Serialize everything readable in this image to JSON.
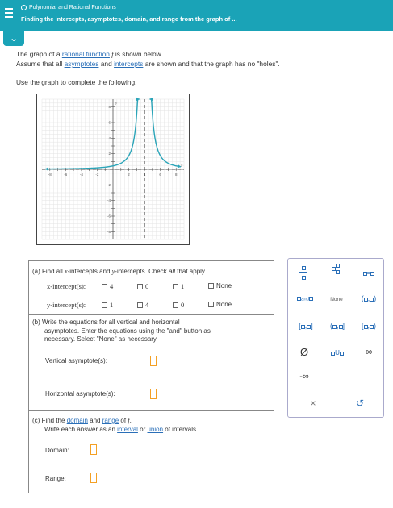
{
  "header": {
    "topic": "Polynomial and Rational Functions",
    "title": "Finding the intercepts, asymptotes, domain, and range from the graph of ..."
  },
  "intro": {
    "line1_a": "The graph of a ",
    "line1_link": "rational function",
    "line1_b": " ",
    "line1_f": "f",
    "line1_c": " is shown below.",
    "line2_a": "Assume that all ",
    "line2_link1": "asymptotes",
    "line2_b": " and ",
    "line2_link2": "intercepts",
    "line2_c": " are shown and that the graph has no \"holes\".",
    "line3": "Use the graph to complete the following."
  },
  "graph": {
    "y_label": "y",
    "x_label": "x",
    "x_tick_labels": [
      "-8",
      "-6",
      "-4",
      "-2",
      "2",
      "4",
      "6",
      "8"
    ],
    "y_tick_labels": [
      "8",
      "6",
      "4",
      "2",
      "-2",
      "-4",
      "-6",
      "-8"
    ]
  },
  "chart_data": {
    "type": "line",
    "title": "",
    "xlabel": "x",
    "ylabel": "y",
    "xlim": [
      -9,
      9
    ],
    "ylim": [
      -9,
      9
    ],
    "grid": true,
    "vertical_asymptote": 4,
    "horizontal_asymptote": 0,
    "series": [
      {
        "x": [
          -8.5,
          -6,
          -4,
          -2,
          0,
          1,
          2,
          2.8,
          3.2,
          3.5,
          3.7
        ],
        "y": [
          0.19,
          0.3,
          0.5,
          0.89,
          1.75,
          3.11,
          7,
          19.4,
          43.7,
          112,
          311
        ]
      },
      {
        "x": [
          4.3,
          4.5,
          4.8,
          5.2,
          6,
          7,
          8,
          8.5
        ],
        "y": [
          311,
          112,
          43.7,
          19.4,
          7,
          3.11,
          1.75,
          1.38
        ]
      }
    ]
  },
  "part_a": {
    "prompt_a": "(a) Find all ",
    "prompt_x": "x",
    "prompt_b": "-intercepts and ",
    "prompt_y": "y",
    "prompt_c": "-intercepts. Check ",
    "prompt_all": "all",
    "prompt_d": " that apply.",
    "x_label": "x-intercept(s):",
    "y_label": "y-intercept(s):",
    "x_options": [
      "4",
      "0",
      "1",
      "None"
    ],
    "y_options": [
      "1",
      "4",
      "0",
      "None"
    ]
  },
  "part_b": {
    "line1": "(b) Write the equations for all vertical and horizontal",
    "line2": "asymptotes. Enter the equations using the \"and\" button as",
    "line3": "necessary. Select \"None\" as necessary.",
    "vertical_label": "Vertical asymptote(s):",
    "horizontal_label": "Horizontal asymptote(s):"
  },
  "part_c": {
    "line1_a": "(c) Find the ",
    "line1_link1": "domain",
    "line1_b": " and ",
    "line1_link2": "range",
    "line1_c": " of ",
    "line1_f": "f",
    "line1_d": ".",
    "line2_a": "Write each answer as an ",
    "line2_link1": "interval",
    "line2_b": " or ",
    "line2_link2": "union",
    "line2_c": " of intervals.",
    "domain_label": "Domain:",
    "range_label": "Range:"
  },
  "keypad": {
    "and_label": "and",
    "none_label": "None",
    "union_label": "U",
    "empty_set": "Ø",
    "infinity": "∞",
    "neg_infinity": "-∞",
    "clear": "×",
    "undo": "↺"
  },
  "colors": {
    "header_bg": "#1aa3b7",
    "curve": "#2aa4b8",
    "link": "#2a6fb8",
    "input_border": "#f4a024"
  }
}
